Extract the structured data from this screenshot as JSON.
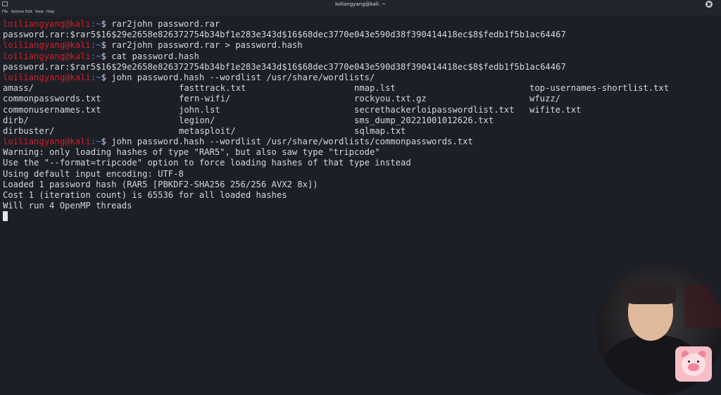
{
  "window": {
    "title": "loiliangyang@kali: ~"
  },
  "menu": [
    "File",
    "Actions",
    "Edit",
    "View",
    "Help"
  ],
  "prompt": {
    "user": "loiliangyang@kali",
    "sep": ":",
    "path": "~",
    "symbol": "$"
  },
  "commands": [
    "rar2john password.rar",
    "rar2john password.rar > password.hash",
    "cat password.hash",
    "john password.hash --wordlist /usr/share/wordlists/",
    "john password.hash --wordlist /usr/share/wordlists/commonpasswords.txt"
  ],
  "outputs": {
    "hash1": "password.rar:$rar5$16$29e2658e826372754b34bf1e283e343d$16$68dec3770e043e590d38f390414418ec$8$fedb1f5b1ac64467",
    "hash2": "password.rar:$rar5$16$29e2658e826372754b34bf1e283e343d$16$68dec3770e043e590d38f390414418ec$8$fedb1f5b1ac64467",
    "listing": [
      [
        "amass/",
        "fasttrack.txt",
        "nmap.lst",
        "top-usernames-shortlist.txt"
      ],
      [
        "commonpasswords.txt",
        "fern-wifi/",
        "rockyou.txt.gz",
        "wfuzz/"
      ],
      [
        "commonusernames.txt",
        "john.lst",
        "secrethackerloipasswordlist.txt",
        "wifite.txt"
      ],
      [
        "dirb/",
        "legion/",
        "sms_dump_20221001012626.txt",
        ""
      ],
      [
        "dirbuster/",
        "metasploit/",
        "sqlmap.txt",
        ""
      ]
    ],
    "john": [
      "Warning: only loading hashes of type \"RAR5\", but also saw type \"tripcode\"",
      "Use the \"--format=tripcode\" option to force loading hashes of that type instead",
      "Using default input encoding: UTF-8",
      "Loaded 1 password hash (RAR5 [PBKDF2-SHA256 256/256 AVX2 8x])",
      "Cost 1 (iteration count) is 65536 for all loaded hashes",
      "Will run 4 OpenMP threads"
    ]
  },
  "colors": {
    "background": "#1d1f26",
    "user": "#d21d25",
    "path": "#3b82f6",
    "text": "#d4d7dd"
  }
}
